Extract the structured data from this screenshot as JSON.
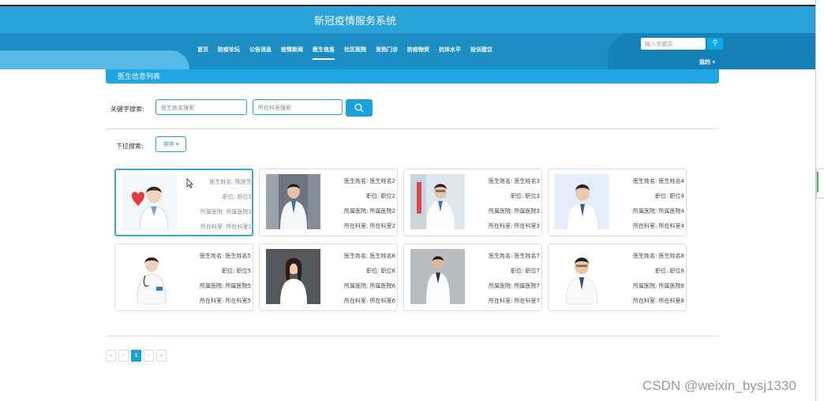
{
  "site": {
    "title": "新冠疫情服务系统",
    "nav": [
      "首页",
      "防疫论坛",
      "公告消息",
      "疫情新闻",
      "医生信息",
      "社区医院",
      "发热门诊",
      "防疫物资",
      "抗体水平",
      "投诉建议"
    ],
    "active_nav": "医生信息",
    "search_placeholder": "输入关键词",
    "user_menu": "我的"
  },
  "colors": {
    "header": "#2aa3d8",
    "accent": "#1ba2de"
  },
  "panel": {
    "title": "医生信息列表",
    "keyword_label": "关键字搜索:",
    "name_placeholder": "医生姓名搜索",
    "dept_placeholder": "所在科室搜索",
    "dropdown_label": "下拉搜索:",
    "sort_label": "排序"
  },
  "doctors": [
    {
      "name": "医生姓名: 陈医生",
      "title": "职位: 职位1",
      "hospital": "所属医院: 所属医院1",
      "dept": "所在科室: 所在科室1"
    },
    {
      "name": "医生姓名: 医生姓名2",
      "title": "职位: 职位2",
      "hospital": "所属医院: 所属医院2",
      "dept": "所在科室: 所在科室2"
    },
    {
      "name": "医生姓名: 医生姓名3",
      "title": "职位: 职位3",
      "hospital": "所属医院: 所属医院3",
      "dept": "所在科室: 所在科室3"
    },
    {
      "name": "医生姓名: 医生姓名4",
      "title": "职位: 职位4",
      "hospital": "所属医院: 所属医院4",
      "dept": "所在科室: 所在科室4"
    },
    {
      "name": "医生姓名: 医生姓名5",
      "title": "职位: 职位5",
      "hospital": "所属医院: 所属医院5",
      "dept": "所在科室: 所在科室5"
    },
    {
      "name": "医生姓名: 医生姓名6",
      "title": "职位: 职位6",
      "hospital": "所属医院: 所属医院6",
      "dept": "所在科室: 所在科室6"
    },
    {
      "name": "医生姓名: 医生姓名7",
      "title": "职位: 职位7",
      "hospital": "所属医院: 所属医院7",
      "dept": "所在科室: 所在科室7"
    },
    {
      "name": "医生姓名: 医生姓名8",
      "title": "职位: 职位8",
      "hospital": "所属医院: 所属医院8",
      "dept": "所在科室: 所在科室8"
    }
  ],
  "pager": {
    "first": "«",
    "prev": "‹",
    "current": "1",
    "next": "›",
    "last": "»"
  },
  "watermark": "CSDN @weixin_bysj1330"
}
